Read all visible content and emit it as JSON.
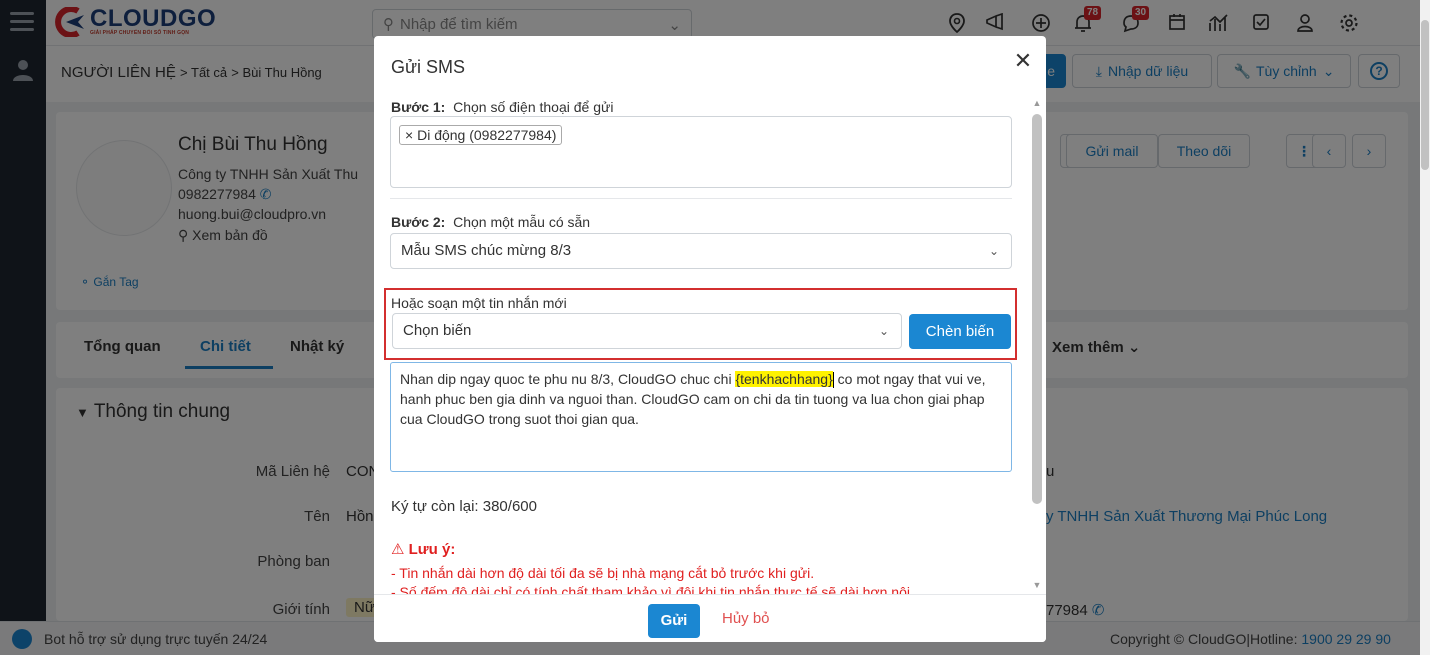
{
  "app": {
    "logo_text": "CLOUDGO",
    "logo_sub": "GIẢI PHÁP CHUYỂN ĐỔI SỐ TINH GỌN",
    "search_placeholder": "Nhập để tìm kiếm",
    "notification_count": "78",
    "message_count": "30"
  },
  "page": {
    "breadcrumb_module": "NGƯỜI LIÊN HỆ",
    "breadcrumb_all": "Tất cả",
    "breadcrumb_record": "Bùi Thu Hồng",
    "btn_edit_partial": "e",
    "btn_import": "Nhập dữ liệu",
    "btn_customize": "Tùy chỉnh",
    "btn_help": "?",
    "btn_send_mail": "Gửi mail",
    "btn_follow": "Theo dõi",
    "contact_name": "Chị Bùi Thu Hồng",
    "company_partial": "Công ty TNHH Sản Xuất Thu",
    "phone": "0982277984",
    "email": "huong.bui@cloudpro.vn",
    "map_link": "Xem bản đồ",
    "tag_link": "Gắn Tag",
    "tabs": [
      "Tổng quan",
      "Chi tiết",
      "Nhật ký"
    ],
    "more_tab": "Xem thêm",
    "section_title": "Thông tin chung",
    "fields": [
      {
        "label": "Mã Liên hệ",
        "value": "CON"
      },
      {
        "label": "Tên",
        "value": "Hồn"
      },
      {
        "label": "Phòng ban",
        "value": ""
      },
      {
        "label": "Giới tính",
        "value": "Nữ"
      }
    ],
    "right_company": "y TNHH Sản Xuất Thương Mại Phúc Long",
    "right_phone": "77984",
    "right_partial": "u"
  },
  "footer": {
    "bot_text": "Bot hỗ trợ sử dụng trực tuyến 24/24",
    "copyright": "Copyright © CloudGO",
    "hotline_label": "Hotline:",
    "hotline": "1900 29 29 90"
  },
  "modal": {
    "title": "Gửi SMS",
    "step1_label": "Bước 1:",
    "step1_text": "Chọn số điện thoại để gửi",
    "phone_chip": "Di động (0982277984)",
    "step2_label": "Bước 2:",
    "step2_text": "Chọn một mẫu có sẵn",
    "template_selected": "Mẫu SMS chúc mừng 8/3",
    "compose_label": "Hoặc soạn một tin nhắn mới",
    "variable_placeholder": "Chọn biến",
    "insert_button": "Chèn biến",
    "message_before": "Nhan dip ngay quoc te phu nu 8/3, CloudGO chuc chi ",
    "message_variable": "{tenkhachhang}",
    "message_after": " co mot ngay that vui ve, hanh phuc ben gia dinh va nguoi than. CloudGO cam on chi da tin tuong va lua chon giai phap cua CloudGO trong suot thoi gian qua.",
    "chars_remaining": "Ký tự còn lại: 380/600",
    "warning_title": "Lưu ý:",
    "warning_line1": "- Tin nhắn dài hơn độ dài tối đa sẽ bị nhà mạng cắt bỏ trước khi gửi.",
    "warning_line2": "- Số đếm độ dài chỉ có tính chất tham khảo vì đôi khi tin nhắn thực tế sẽ dài hơn nội",
    "send_button": "Gửi",
    "cancel_button": "Hủy bỏ"
  }
}
